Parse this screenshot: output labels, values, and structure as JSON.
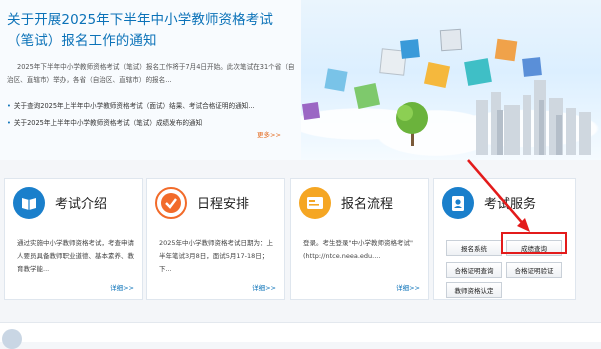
{
  "notice": {
    "title": "关于开展2025年下半年中小学教师资格考试（笔试）报名工作的通知",
    "summary": "2025年下半年中小学教师资格考试（笔试）报名工作将于7月4日开始。此次笔试在31个省（自治区、直辖市）举办，各省（自治区、直辖市）的报名...",
    "news": [
      "关于查询2025年上半年中小学教师资格考试（面试）结果、考试合格证明的通知...",
      "关于2025年上半年中小学教师资格考试（笔试）成绩发布的通知"
    ],
    "more": "更多>>"
  },
  "cards": [
    {
      "title": "考试介绍",
      "body": "通过实施中小学教师资格考试，考查申请人要员具备教师职业道德、基本素养、教育教学能...",
      "more": "详细>>"
    },
    {
      "title": "日程安排",
      "body": "2025年中小学教师资格考试日期为：上半年笔试3月8日，面试5月17-18日；下...",
      "more": "详细>>"
    },
    {
      "title": "报名流程",
      "body": "登录。考生登录\"中小学教师资格考试\"(http://ntce.neea.edu....",
      "more": "详细>>"
    },
    {
      "title": "考试服务",
      "buttons": [
        "报名系统",
        "成绩查询",
        "合格证明查询",
        "合格证明验证",
        "教师资格认定"
      ]
    }
  ],
  "colors": {
    "accent": "#0b72b8",
    "highlight": "#e31b1b",
    "more": "#e36a1e"
  }
}
